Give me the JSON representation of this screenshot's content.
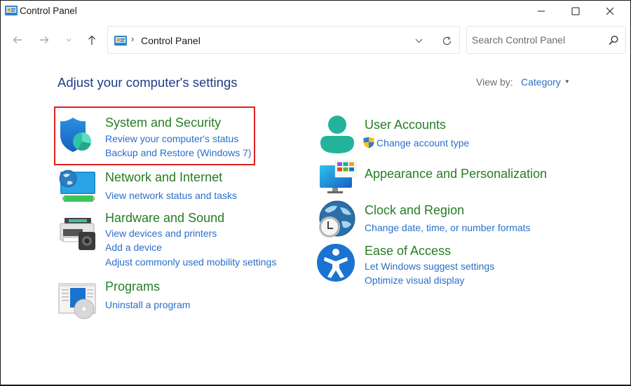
{
  "window": {
    "title": "Control Panel",
    "controls": {
      "minimize": "minimize",
      "maximize": "maximize",
      "close": "close"
    }
  },
  "nav": {
    "address": {
      "path": [
        "Control Panel"
      ],
      "separator": "›"
    },
    "search": {
      "placeholder": "Search Control Panel",
      "value": ""
    }
  },
  "main": {
    "heading": "Adjust your computer's settings",
    "view_by": {
      "label": "View by:",
      "selected": "Category"
    },
    "highlighted_category": "System and Security",
    "highlight_color": "#e02020",
    "colors": {
      "title_green": "#267d26",
      "link_blue": "#2a6fc9",
      "heading_blue": "#1f3c88"
    },
    "left_categories": [
      {
        "title": "System and Security",
        "icon": "shield-icon",
        "links": [
          "Review your computer's status",
          "Backup and Restore (Windows 7)"
        ]
      },
      {
        "title": "Network and Internet",
        "icon": "network-icon",
        "links": [
          "View network status and tasks"
        ]
      },
      {
        "title": "Hardware and Sound",
        "icon": "printer-speaker-icon",
        "links": [
          "View devices and printers",
          "Add a device",
          "Adjust commonly used mobility settings"
        ]
      },
      {
        "title": "Programs",
        "icon": "programs-disc-icon",
        "links": [
          "Uninstall a program"
        ]
      }
    ],
    "right_categories": [
      {
        "title": "User Accounts",
        "icon": "user-icon",
        "links": [
          "Change account type"
        ],
        "link_icons": [
          "uac-shield-icon"
        ]
      },
      {
        "title": "Appearance and Personalization",
        "icon": "monitor-personalization-icon",
        "links": []
      },
      {
        "title": "Clock and Region",
        "icon": "globe-clock-icon",
        "links": [
          "Change date, time, or number formats"
        ]
      },
      {
        "title": "Ease of Access",
        "icon": "accessibility-icon",
        "links": [
          "Let Windows suggest settings",
          "Optimize visual display"
        ]
      }
    ]
  }
}
